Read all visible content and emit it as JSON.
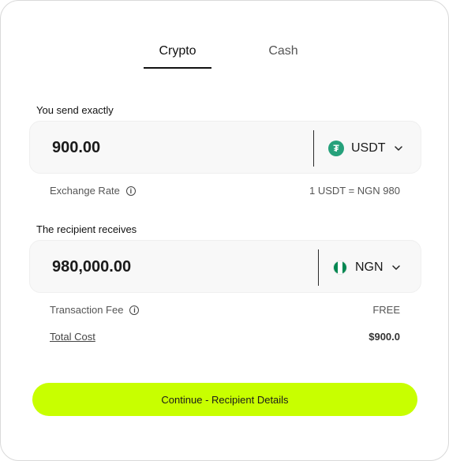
{
  "tabs": {
    "crypto": "Crypto",
    "cash": "Cash",
    "active": "crypto"
  },
  "send": {
    "label": "You send exactly",
    "amount": "900.00",
    "currency": "USDT",
    "currency_icon": "tether-icon"
  },
  "exchange": {
    "label": "Exchange Rate",
    "value": "1 USDT = NGN 980"
  },
  "receive": {
    "label": "The recipient receives",
    "amount": "980,000.00",
    "currency": "NGN",
    "currency_icon": "nigeria-flag-icon"
  },
  "fee": {
    "label": "Transaction Fee",
    "value": "FREE"
  },
  "total": {
    "label": "Total Cost",
    "value": "$900.0"
  },
  "continue_label": "Continue - Recipient Details",
  "colors": {
    "accent": "#c8ff00",
    "tether": "#26a17b",
    "nigeria_green": "#008751"
  }
}
